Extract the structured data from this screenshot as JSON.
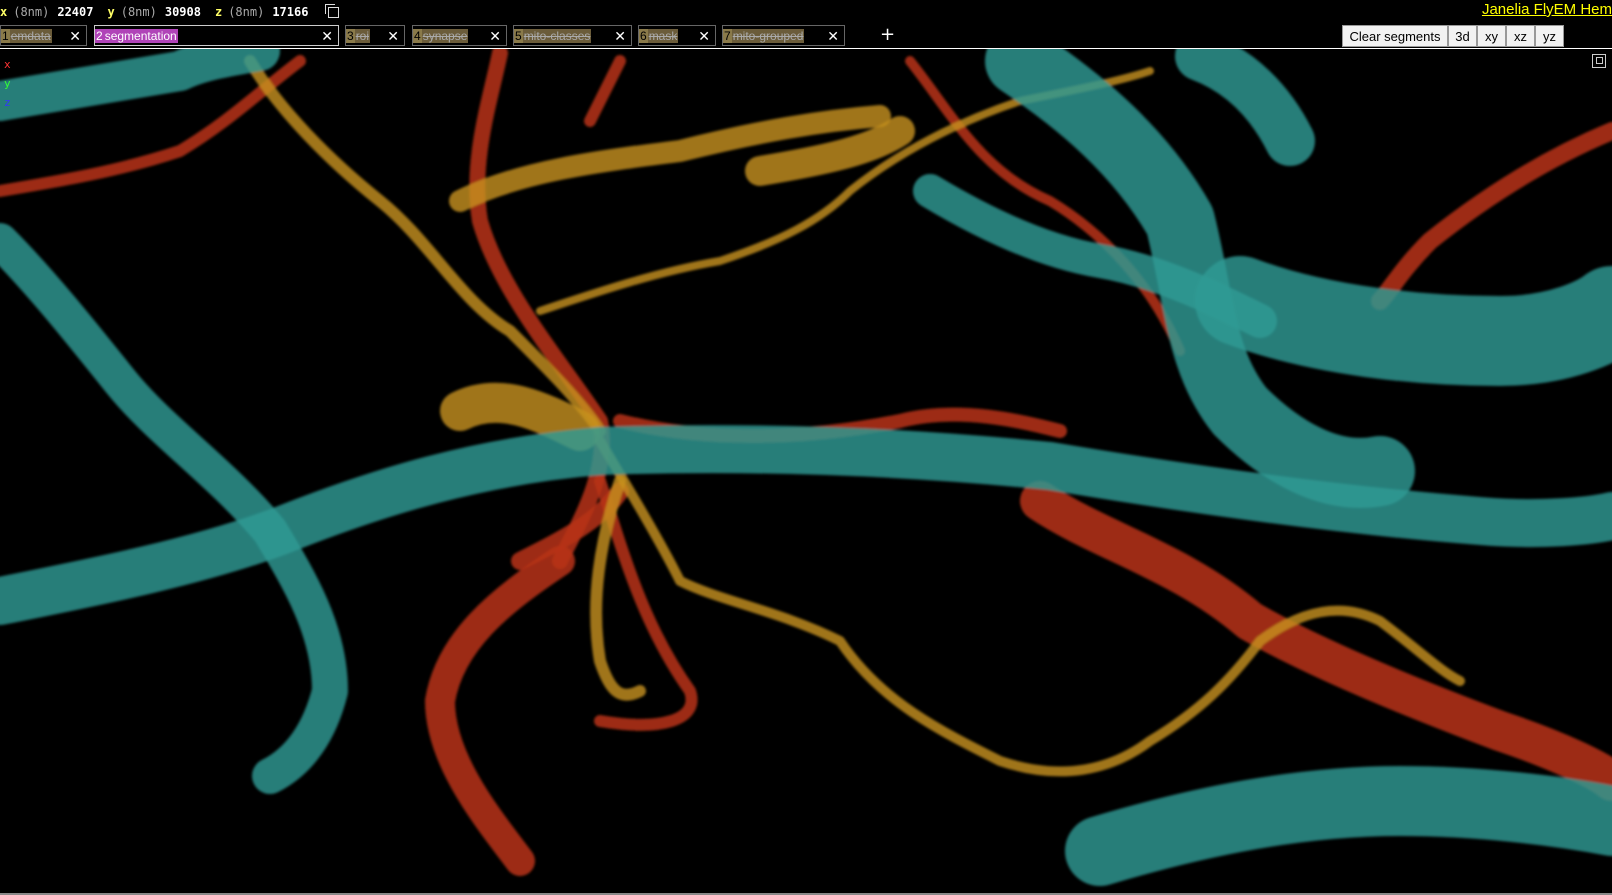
{
  "coords": [
    {
      "axis": "x",
      "unit": "(8nm)",
      "value": "22407"
    },
    {
      "axis": "y",
      "unit": "(8nm)",
      "value": "30908"
    },
    {
      "axis": "z",
      "unit": "(8nm)",
      "value": "17166"
    }
  ],
  "brand": "Janelia FlyEM Hem",
  "layers": [
    {
      "num": "1",
      "name": "emdata"
    },
    {
      "num": "2",
      "name": "segmentation"
    },
    {
      "num": "3",
      "name": "roi"
    },
    {
      "num": "4",
      "name": "synapse"
    },
    {
      "num": "5",
      "name": "mito-classes"
    },
    {
      "num": "6",
      "name": "mask"
    },
    {
      "num": "7",
      "name": "mito-grouped"
    }
  ],
  "layer_close_glyph": "✕",
  "add_layer_glyph": "+",
  "toolbar": {
    "clear_segments": "Clear segments",
    "view_3d": "3d",
    "view_xy": "xy",
    "view_xz": "xz",
    "view_yz": "yz"
  },
  "axes_legend": {
    "x": "x",
    "y": "y",
    "z": "z"
  },
  "segment_colors": {
    "teal": "#2e9a94",
    "orange": "#c8921e",
    "red": "#b83418"
  }
}
